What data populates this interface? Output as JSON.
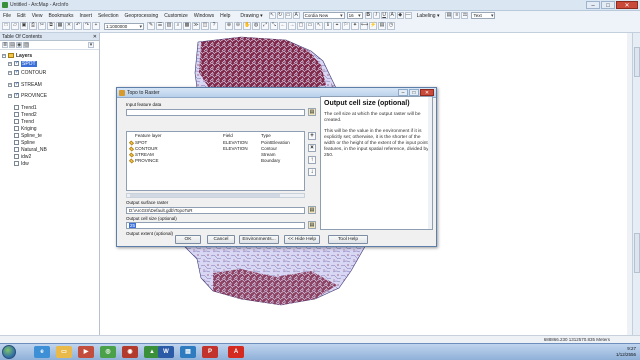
{
  "window": {
    "title": "Untitled - ArcMap - ArcInfo",
    "min": "–",
    "max": "□",
    "close": "✕"
  },
  "menu": {
    "items": [
      "File",
      "Edit",
      "View",
      "Bookmarks",
      "Insert",
      "Selection",
      "Geoprocessing",
      "Customize",
      "Windows",
      "Help"
    ],
    "drawing_label": "Drawing ▾",
    "font_name": "Cordia New",
    "font_size": "16",
    "labeling_label": "Labeling ▾",
    "symbol_combo": "Text"
  },
  "toolbar": {
    "scale": "1:1000000"
  },
  "toc": {
    "title": "Table Of Contents",
    "close": "✕",
    "root": "Layers",
    "layers": [
      {
        "name": "SPOT",
        "checked": true,
        "expanded": true,
        "selected": true
      },
      {
        "name": "CONTOUR",
        "checked": true,
        "expanded": true,
        "selected": false
      },
      {
        "name": "STREAM",
        "checked": true,
        "expanded": true,
        "selected": false
      },
      {
        "name": "PROVINCE",
        "checked": true,
        "expanded": true,
        "selected": false
      },
      {
        "name": "Trend1",
        "checked": false,
        "expanded": false,
        "selected": false
      },
      {
        "name": "Trend2",
        "checked": false,
        "expanded": false,
        "selected": false
      },
      {
        "name": "Trend",
        "checked": false,
        "expanded": false,
        "selected": false
      },
      {
        "name": "Kriging",
        "checked": false,
        "expanded": false,
        "selected": false
      },
      {
        "name": "Spline_te",
        "checked": false,
        "expanded": false,
        "selected": false
      },
      {
        "name": "Spline",
        "checked": false,
        "expanded": false,
        "selected": false
      },
      {
        "name": "Natural_NB",
        "checked": false,
        "expanded": false,
        "selected": false
      },
      {
        "name": "idw2",
        "checked": false,
        "expanded": false,
        "selected": false
      },
      {
        "name": "Idw",
        "checked": false,
        "expanded": false,
        "selected": false
      }
    ]
  },
  "dialog": {
    "title": "Topo to Raster",
    "input_label": "Input feature data",
    "columns": [
      "Feature layer",
      "Field",
      "Type"
    ],
    "rows": [
      {
        "layer": "SPOT",
        "field": "ELEVATION",
        "type": "PointElevation"
      },
      {
        "layer": "CONTOUR",
        "field": "ELEVATION",
        "type": "Contour"
      },
      {
        "layer": "STREAM",
        "field": "",
        "type": "Stream"
      },
      {
        "layer": "PROVINCE",
        "field": "",
        "type": "Boundary"
      }
    ],
    "side_buttons": [
      "+",
      "×",
      "↑",
      "↓"
    ],
    "output_raster_label": "Output surface raster",
    "output_raster_value": "D:\\ArcGIS\\Default.gdb\\TopoToR",
    "cell_size_label": "Output cell size (optional)",
    "cell_size_value": "25",
    "extent_label": "Output extent (optional)",
    "help_title": "Output cell size (optional)",
    "help_p1": "The cell size at which the output raster will be created.",
    "help_p2": "This will be the value in the environment if it is explicitly set; otherwise, it is the shorter of the width or the height of the extent of the input point features, in the input spatial reference, divided by 250.",
    "buttons": {
      "ok": "OK",
      "cancel": "Cancel",
      "environments": "Environments...",
      "hide_help": "<< Hide Help",
      "tool_help": "Tool Help"
    }
  },
  "status": {
    "coords": "688866.230  1312570.835 Meters"
  },
  "tray": {
    "time": "9:27",
    "date": "1/12/2556"
  },
  "colors": {
    "map_fill": "#d8d7f4",
    "map_dense": "#7a1a3a",
    "accent": "#3a6fd8"
  }
}
